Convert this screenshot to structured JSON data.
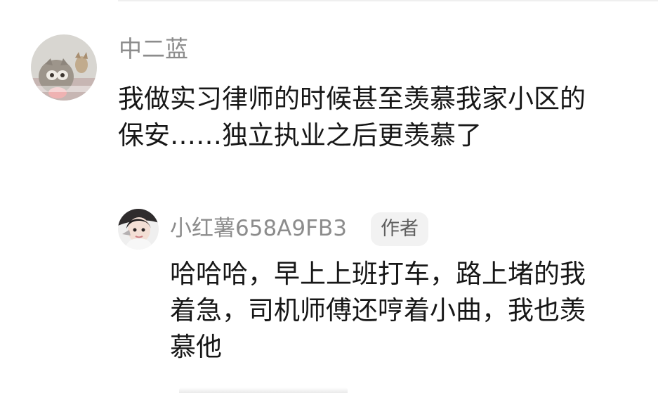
{
  "thread": {
    "comment": {
      "username": "中二蓝",
      "avatar_icon": "cat-photo-avatar",
      "text_lines": [
        "我做实习律师的时候甚至羡慕我家小区的",
        "保安……独立执业之后更羡慕了"
      ]
    },
    "reply": {
      "username": "小红薯658A9FB3",
      "author_badge": "作者",
      "avatar_icon": "girl-photo-avatar",
      "text_lines": [
        "哈哈哈，早上上班打车，路上堵的我",
        "着急，司机师傅还哼着小曲，我也羡",
        "慕他"
      ]
    }
  },
  "colors": {
    "username": "#8c8c8c",
    "text": "#171717",
    "badge_bg": "#f2f2f2",
    "badge_text": "#5f5f5f"
  }
}
